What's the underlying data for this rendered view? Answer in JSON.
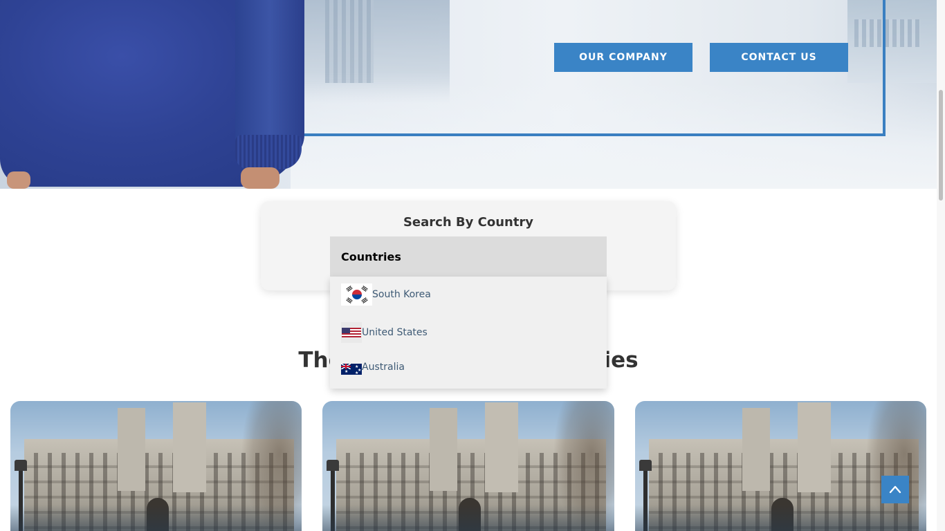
{
  "hero": {
    "buttons": {
      "our_company": "OUR COMPANY",
      "contact_us": "CONTACT US"
    },
    "accent_color": "#3a84c6"
  },
  "search": {
    "title": "Search By Country",
    "select": {
      "label": "Countries",
      "expanded": true,
      "options": [
        {
          "label": "South Korea",
          "flag_icon": "south-korea-flag-icon"
        },
        {
          "label": "United States",
          "flag_icon": "united-states-flag-icon"
        },
        {
          "label": "Australia",
          "flag_icon": "australia-flag-icon"
        }
      ]
    }
  },
  "section": {
    "title_left": "The",
    "title_right": "ties"
  },
  "cards": [
    {
      "image": "university-building-photo"
    },
    {
      "image": "university-building-photo"
    },
    {
      "image": "university-building-photo"
    }
  ],
  "back_to_top": {
    "icon": "chevron-up-icon"
  }
}
